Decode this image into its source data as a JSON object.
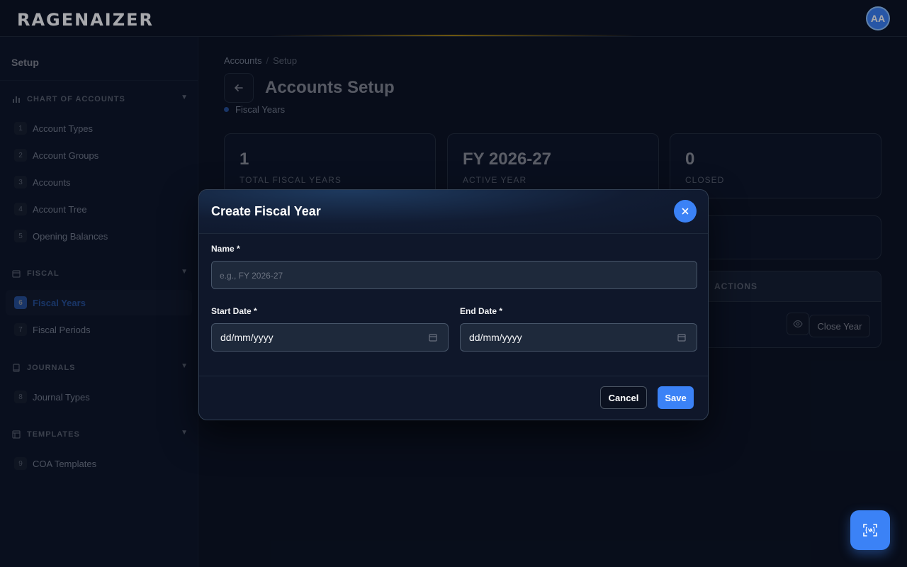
{
  "app": {
    "logo_text": "RAGENAIZER",
    "avatar_initials": "AA"
  },
  "sidebar": {
    "title": "Setup",
    "sections": [
      {
        "label": "CHART OF ACCOUNTS",
        "icon": "bar-chart-icon",
        "items": [
          {
            "num": "1",
            "label": "Account Types"
          },
          {
            "num": "2",
            "label": "Account Groups"
          },
          {
            "num": "3",
            "label": "Accounts"
          },
          {
            "num": "4",
            "label": "Account Tree"
          },
          {
            "num": "5",
            "label": "Opening Balances"
          }
        ]
      },
      {
        "label": "FISCAL",
        "icon": "calendar-icon",
        "items": [
          {
            "num": "6",
            "label": "Fiscal Years",
            "active": true
          },
          {
            "num": "7",
            "label": "Fiscal Periods"
          }
        ]
      },
      {
        "label": "JOURNALS",
        "icon": "book-icon",
        "items": [
          {
            "num": "8",
            "label": "Journal Types"
          }
        ]
      },
      {
        "label": "TEMPLATES",
        "icon": "layout-icon",
        "items": [
          {
            "num": "9",
            "label": "COA Templates"
          }
        ]
      }
    ]
  },
  "main": {
    "breadcrumb": [
      "Accounts",
      "Setup"
    ],
    "breadcrumb_sep": "/",
    "title": "Accounts Setup",
    "subtitle": "Fiscal Years",
    "stats": [
      {
        "value": "1",
        "label": "TOTAL FISCAL YEARS"
      },
      {
        "value": "FY 2026-27",
        "label": "ACTIVE YEAR"
      },
      {
        "value": "0",
        "label": "CLOSED"
      }
    ],
    "table": {
      "actions_header": "ACTIONS",
      "row_action": "Close Year"
    }
  },
  "modal": {
    "title": "Create Fiscal Year",
    "name_label": "Name *",
    "name_placeholder": "e.g., FY 2026-27",
    "start_label": "Start Date *",
    "start_value": "dd/mm/yyyy",
    "end_label": "End Date *",
    "end_value": "dd/mm/yyyy",
    "cancel": "Cancel",
    "save": "Save"
  },
  "colors": {
    "accent": "#3b82f6",
    "background": "#0b1120",
    "panel": "#0f172a"
  }
}
